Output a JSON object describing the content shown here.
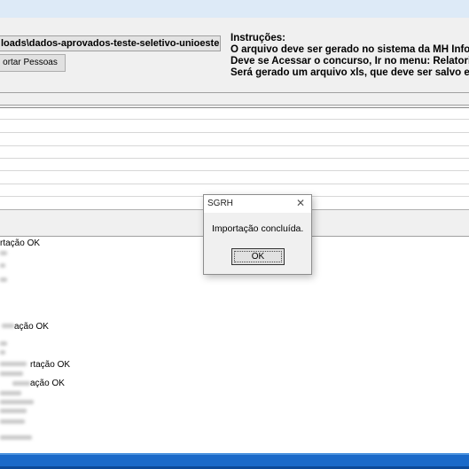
{
  "toolbar": {
    "file_path": "loads\\dados-aprovados-teste-seletivo-unioeste.csv",
    "import_button": "ortar Pessoas"
  },
  "instructions": {
    "title": "Instruções:",
    "line1": "O arquivo deve ser gerado no sistema da MH Inform",
    "line2": "Deve se Acessar o concurso, Ir no menu:  Relatorio",
    "line3": "Será gerado um arquivo xls, que deve ser salvo em"
  },
  "log": {
    "lines": [
      "rtação OK",
      "ação OK",
      "rtação OK",
      "ação OK"
    ]
  },
  "dialog": {
    "title": "SGRH",
    "close": "✕",
    "message": "Importação concluída.",
    "ok_label": "OK"
  }
}
